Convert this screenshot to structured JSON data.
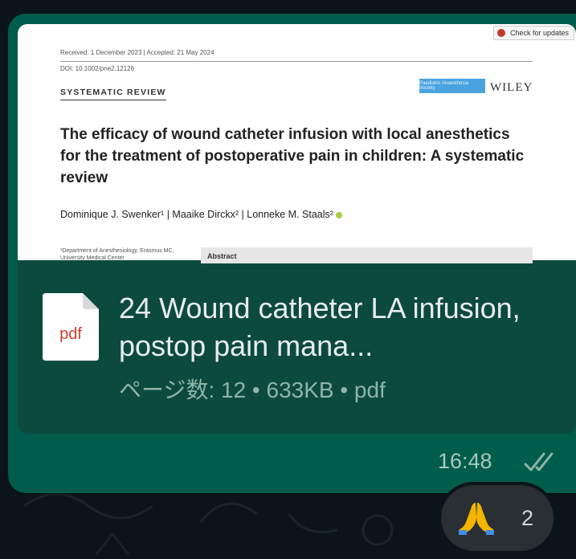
{
  "preview": {
    "badge": "Check for updates",
    "received": "Received: 1 December 2023   |   Accepted: 21 May 2024",
    "doi": "DOI: 10.1002/pne2.12126",
    "section": "SYSTEMATIC REVIEW",
    "society": "Paediatric Anaesthesia Society",
    "publisher": "WILEY",
    "title": "The efficacy of wound catheter infusion with local anesthetics for the treatment of postoperative pain in children: A systematic review",
    "authors": "Dominique J. Swenker¹  |  Maaike Dirckx²  |  Lonneke M. Staals²",
    "affiliation": "¹Department of Anesthesiology, Erasmus MC, University Medical Center",
    "abstract": "Abstract"
  },
  "file": {
    "icon": "pdf-file-icon",
    "type_label": "pdf",
    "name": "24 Wound catheter LA infusion, postop pain mana...",
    "meta": "ページ数: 12 • 633KB • pdf"
  },
  "message": {
    "time": "16:48",
    "status_icon": "double-check-icon"
  },
  "reaction": {
    "emoji_icon": "folded-hands-icon",
    "count": "2"
  },
  "colors": {
    "outer_background": "#3b5bd6",
    "chat_background": "#0b141a",
    "bubble": "#005c4b",
    "file_card": "#0c4a3e",
    "reaction_pill": "#2a2f33"
  }
}
